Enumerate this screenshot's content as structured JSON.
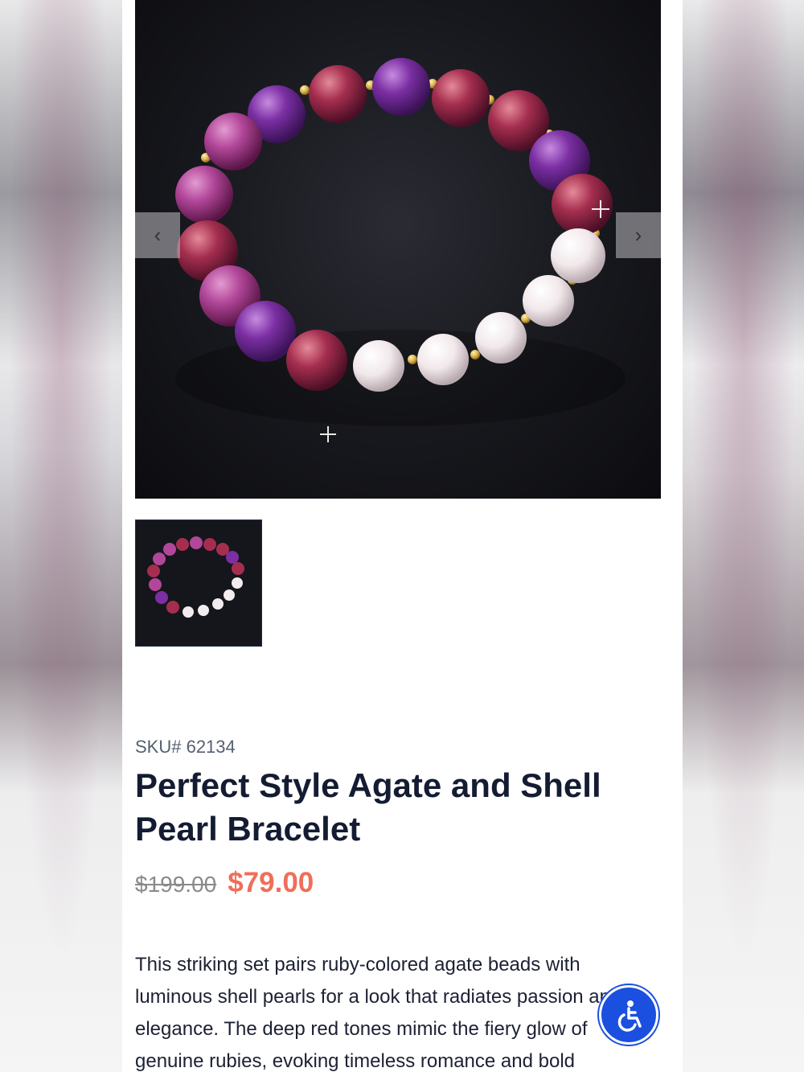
{
  "gallery": {
    "main_image": "purple and red agate bead bracelet with white shell pearls and gold spacers",
    "prev_icon": "chevron-left-icon",
    "next_icon": "chevron-right-icon",
    "thumbnail_image": "bracelet thumbnail"
  },
  "product": {
    "sku": "SKU# 62134",
    "title": "Perfect Style Agate and Shell Pearl Bracelet",
    "old_price": "$199.00",
    "price": "$79.00",
    "description": "This striking set pairs ruby-colored agate beads with luminous shell pearls for a look that radiates passion and elegance. The deep red tones mimic the fiery glow of genuine rubies, evoking timeless romance and bold"
  },
  "accessibility_button": {
    "icon": "accessibility-icon"
  },
  "colors": {
    "title": "#141c33",
    "sale_price": "#ef6e5a",
    "old_price": "#8a8a8a",
    "accessibility_blue": "#1b4fe0"
  }
}
